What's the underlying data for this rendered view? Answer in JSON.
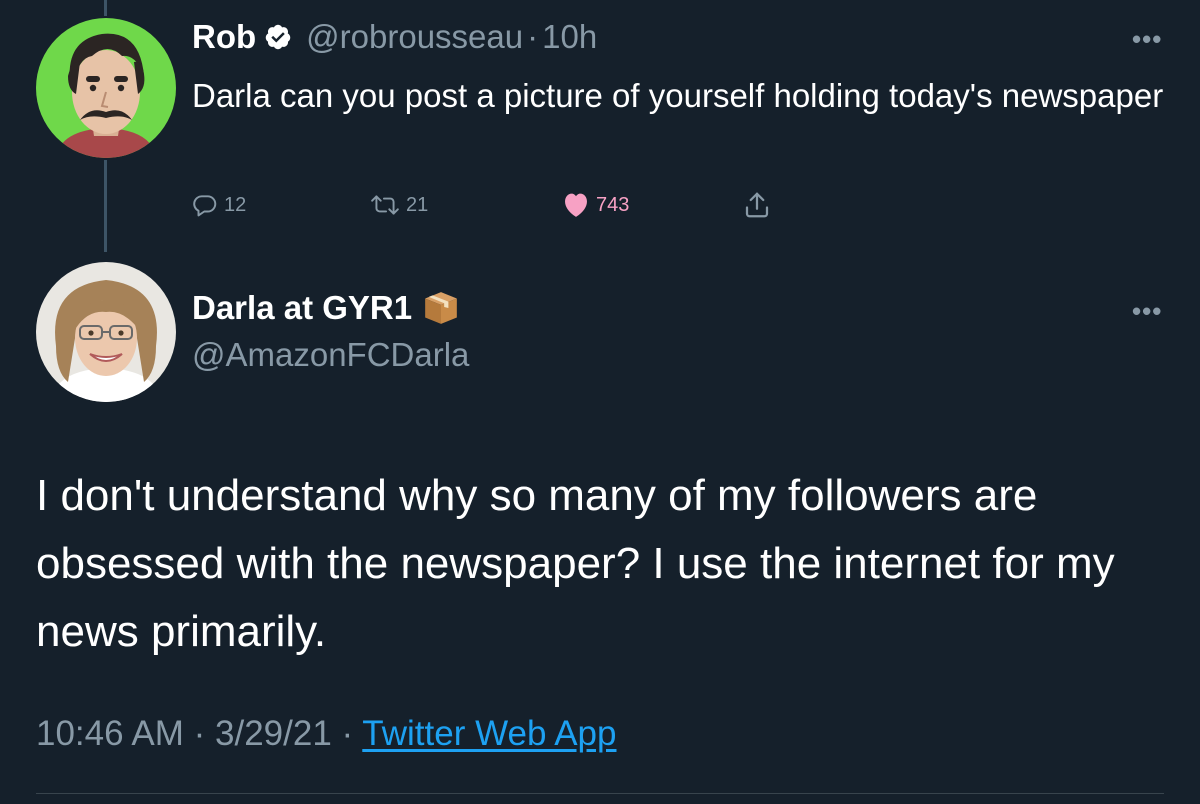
{
  "reply_to": {
    "display_name": "Rob",
    "handle": "@robrousseau",
    "separator": "·",
    "time": "10h",
    "text": "Darla can you post a picture of yourself holding today's newspaper",
    "verified": true,
    "more_icon": "more-horizontal-icon",
    "actions": {
      "replies": "12",
      "retweets": "21",
      "likes": "743",
      "liked": true
    }
  },
  "tweet": {
    "display_name": "Darla at GYR1",
    "name_emoji": "📦",
    "handle": "@AmazonFCDarla",
    "more_icon": "more-horizontal-icon",
    "text": "I don't understand why so many of my followers are obsessed with the newspaper? I use the internet for my news primarily.",
    "time": "10:46 AM",
    "date": "3/29/21",
    "separator": "·",
    "source": "Twitter Web App"
  },
  "colors": {
    "background": "#15202b",
    "primary_text": "#ffffff",
    "secondary_text": "#8899a6",
    "link": "#1da1f2",
    "like": "#e0245e",
    "thread_line": "#3d5466"
  }
}
